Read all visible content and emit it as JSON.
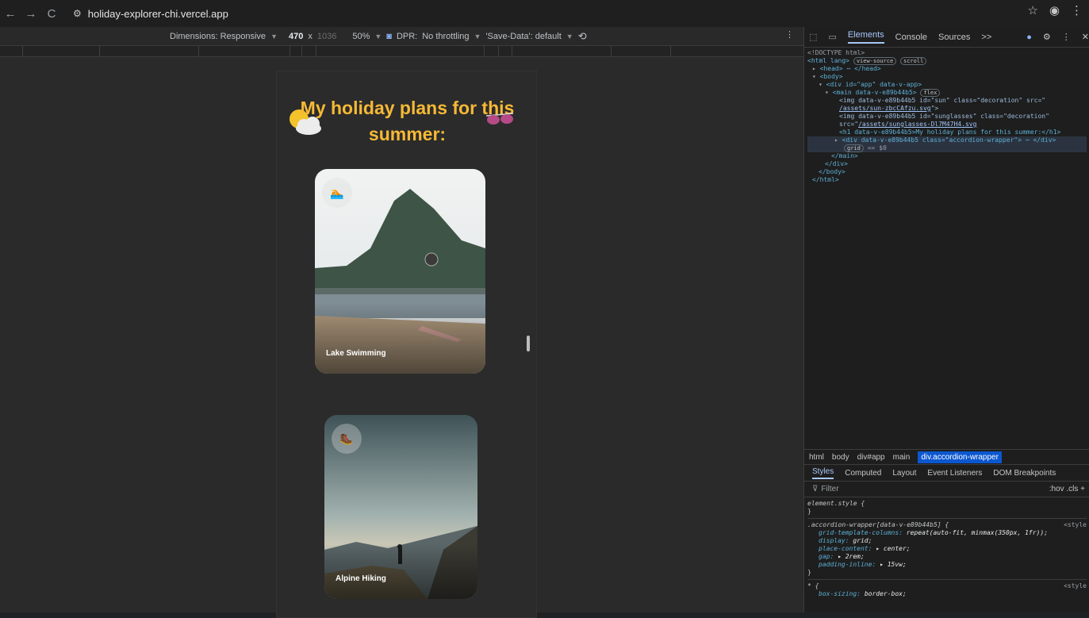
{
  "browser": {
    "url": "holiday-explorer-chi.vercel.app",
    "nav": [
      "←",
      "→",
      "C"
    ]
  },
  "device_toolbar": {
    "dimensions_label": "Dimensions: Responsive",
    "width": "470",
    "x_sep": "x",
    "height": "1036",
    "zoom": "50%",
    "dpr": "DPR:",
    "throttle": "No throttling",
    "save_data": "'Save-Data': default"
  },
  "page": {
    "headline": "My holiday plans for this summer:",
    "cards": [
      {
        "title": "Lake Swimming",
        "badge": "🏊"
      },
      {
        "title": "Alpine Hiking",
        "badge": "🥾"
      }
    ]
  },
  "devtools": {
    "tabs": [
      "Elements",
      "Console",
      "Sources",
      ">>"
    ],
    "active_tab": "Elements",
    "dom": {
      "doctype": "<!DOCTYPE html>",
      "html_open": "<html lang>",
      "pill_view_source": "view-source",
      "pill_scroll": "scroll",
      "head": "<head> ⋯ </head>",
      "body": "<body>",
      "div_app": "<div id=\"app\" data-v-app>",
      "main": "<main data-v-e89b44b5>",
      "pill_flex": "flex",
      "img_sun_1": "<img data-v-e89b44b5 id=\"sun\" class=\"decoration\" src=\"",
      "img_sun_link": "/assets/sun-zbcCAfzu.svg",
      "img_sun_2": "\">",
      "img_sg_1": "<img data-v-e89b44b5 id=\"sunglasses\" class=\"decoration\"",
      "img_sg_src": "src=\"",
      "img_sg_link": "/assets/sunglasses-Dl7M47H4.svg",
      "h1": "<h1 data-v-e89b44b5>My holiday plans for this summer:</h1>",
      "div_wrap": "<div data-v-e89b44b5 class=\"accordion-wrapper\"> ⋯ </div>",
      "pill_grid": "grid",
      "eq": "== $0",
      "main_close": "</main>",
      "div_close": "</div>",
      "body_close": "</body>",
      "html_close": "</html>"
    },
    "breadcrumbs": [
      "html",
      "body",
      "div#app",
      "main",
      "div.accordion-wrapper"
    ],
    "sub_tabs": [
      "Styles",
      "Computed",
      "Layout",
      "Event Listeners",
      "DOM Breakpoints"
    ],
    "filter_placeholder": "Filter",
    "filter_tools": ":hov .cls +",
    "css": {
      "element_style": "element.style {",
      "close": "}",
      "rule_selector": ".accordion-wrapper[data-v-e89b44b5] {",
      "origin": "<style",
      "props": [
        {
          "name": "grid-template-columns:",
          "value": "repeat(auto-fit, minmax(350px, 1fr));"
        },
        {
          "name": "display:",
          "value": "grid;"
        },
        {
          "name": "place-content:",
          "value": "▸ center;"
        },
        {
          "name": "gap:",
          "value": "▸ 2rem;"
        },
        {
          "name": "padding-inline:",
          "value": "▸ 15vw;"
        }
      ],
      "star_selector": "* {",
      "star_prop": "box-sizing:",
      "star_value": "border-box;"
    }
  }
}
